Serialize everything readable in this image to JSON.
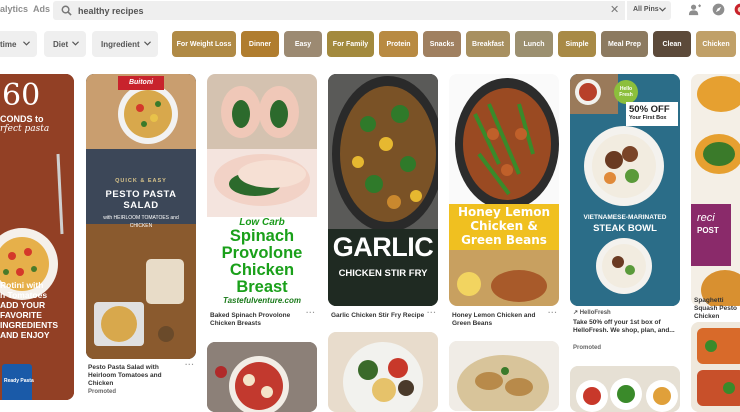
{
  "top": {
    "nav_analytics": "alytics",
    "nav_ads": "Ads",
    "search_value": "healthy recipes",
    "scope": "All Pins"
  },
  "filters": [
    "time",
    "Diet",
    "Ingredient"
  ],
  "guides": [
    {
      "label": "For Weight Loss",
      "color": "#b08a45"
    },
    {
      "label": "Dinner",
      "color": "#b07d2f"
    },
    {
      "label": "Easy",
      "color": "#9c8a72"
    },
    {
      "label": "For Family",
      "color": "#a38a3e"
    },
    {
      "label": "Protein",
      "color": "#b88a42"
    },
    {
      "label": "Snacks",
      "color": "#a08060"
    },
    {
      "label": "Breakfast",
      "color": "#a89060"
    },
    {
      "label": "Lunch",
      "color": "#9c9070"
    },
    {
      "label": "Simple",
      "color": "#a88a46"
    },
    {
      "label": "Meal Prep",
      "color": "#8c7a60"
    },
    {
      "label": "Clean",
      "color": "#5c4a3a"
    },
    {
      "label": "Chicken",
      "color": "#c0a068"
    }
  ],
  "pins": {
    "pasta": {
      "line1": "60",
      "line2": "CONDS to",
      "line3": "rfect pasta",
      "bottom_text": "Rotini with\nh Tomatoes\nADD YOUR\nFAVORITE\nINGREDIENTS\nAND ENJOY",
      "brand": "Ready Pasta"
    },
    "pesto": {
      "brand": "Buitoni",
      "tagline": "QUICK & EASY",
      "heading": "PESTO PASTA SALAD",
      "subheading": "with HEIRLOOM TOMATOES and CHICKEN",
      "title": "Pesto Pasta Salad with Heirloom Tomatoes and Chicken",
      "promoted": "Promoted"
    },
    "spinach": {
      "overlay_1": "Low Carb",
      "overlay_2": "Spinach\nProvolone\nChicken\nBreast",
      "site": "Tastefulventure.com",
      "title": "Baked Spinach Provolone Chicken Breasts"
    },
    "garlic": {
      "overlay_1": "GARLIC",
      "overlay_2": "CHICKEN STIR FRY",
      "title": "Garlic Chicken Stir Fry Recipe"
    },
    "honey": {
      "overlay": "Honey Lemon\nChicken &\nGreen Beans",
      "title": "Honey Lemon Chicken and Green Beans"
    },
    "hellofresh": {
      "logo": "Hello\nFresh",
      "offer_1": "50% OFF",
      "offer_2": "Your First Box",
      "banner_1": "VIETNAMESE-MARINATED",
      "banner_2": "STEAK BOWL",
      "source": "HelloFresh",
      "title": "Take 50% off your 1st box of HelloFresh. We shop, plan, and...",
      "promoted": "Promoted"
    },
    "recipost": {
      "logo_1": "reci",
      "logo_2": "POST",
      "title": "Spaghetti Squash Pesto Chicken"
    }
  }
}
